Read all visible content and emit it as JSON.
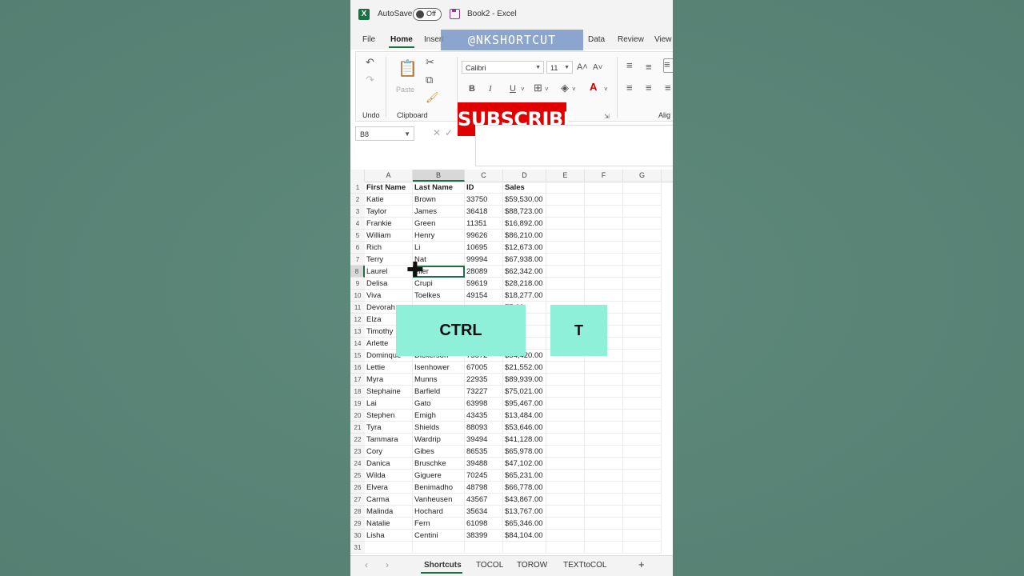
{
  "titlebar": {
    "autosave_label": "AutoSave",
    "autosave_state": "Off",
    "doc_title": "Book2  -  Excel"
  },
  "ribbon_tabs": [
    "File",
    "Home",
    "Insert",
    "Data",
    "Review",
    "View"
  ],
  "watermark": "@NKSHORTCUT",
  "ribbon": {
    "undo_group": "Undo",
    "clipboard_group": "Clipboard",
    "paste_label": "Paste",
    "font_name": "Calibri",
    "font_size": "11",
    "align_group": "Alig",
    "bold": "B",
    "italic": "I",
    "underline": "U"
  },
  "subscribe_banner": "SUBSCRIBE",
  "formula_bar": {
    "name_box": "B8"
  },
  "sheet": {
    "columns": [
      "A",
      "B",
      "C",
      "D",
      "E",
      "F",
      "G"
    ],
    "selected_column": "B",
    "selected_row": 8,
    "rows": [
      [
        "First Name",
        "Last Name",
        "ID",
        "Sales"
      ],
      [
        "Katie",
        "Brown",
        "33750",
        "$59,530.00"
      ],
      [
        "Taylor",
        "James",
        "36418",
        "$88,723.00"
      ],
      [
        "Frankie",
        "Green",
        "11351",
        "$16,892.00"
      ],
      [
        "William",
        "Henry",
        "99626",
        "$86,210.00"
      ],
      [
        "Rich",
        "Li",
        "10695",
        "$12,673.00"
      ],
      [
        "Terry",
        "Nat",
        "99994",
        "$67,938.00"
      ],
      [
        "Laurel",
        "eller",
        "28089",
        "$62,342.00"
      ],
      [
        "Delisa",
        "Crupi",
        "59619",
        "$28,218.00"
      ],
      [
        "Viva",
        "Toelkes",
        "49154",
        "$18,277.00"
      ],
      [
        "Devorah",
        "",
        "",
        "77.00"
      ],
      [
        "Elza",
        "",
        "",
        "11.00"
      ],
      [
        "Timothy",
        "",
        "",
        "58.00"
      ],
      [
        "Arlette",
        "",
        "",
        "27.00"
      ],
      [
        "Dominque",
        "Dickerson",
        "75572",
        "$54,420.00"
      ],
      [
        "Lettie",
        "Isenhower",
        "67005",
        "$21,552.00"
      ],
      [
        "Myra",
        "Munns",
        "22935",
        "$89,939.00"
      ],
      [
        "Stephaine",
        "Barfield",
        "73227",
        "$75,021.00"
      ],
      [
        "Lai",
        "Gato",
        "63998",
        "$95,467.00"
      ],
      [
        "Stephen",
        "Emigh",
        "43435",
        "$13,484.00"
      ],
      [
        "Tyra",
        "Shields",
        "88093",
        "$53,646.00"
      ],
      [
        "Tammara",
        "Wardrip",
        "39494",
        "$41,128.00"
      ],
      [
        "Cory",
        "Gibes",
        "86535",
        "$65,978.00"
      ],
      [
        "Danica",
        "Bruschke",
        "39488",
        "$47,102.00"
      ],
      [
        "Wilda",
        "Giguere",
        "70245",
        "$65,231.00"
      ],
      [
        "Elvera",
        "Benimadho",
        "48798",
        "$66,778.00"
      ],
      [
        "Carma",
        "Vanheusen",
        "43567",
        "$43,867.00"
      ],
      [
        "Malinda",
        "Hochard",
        "35634",
        "$13,767.00"
      ],
      [
        "Natalie",
        "Fern",
        "61098",
        "$65,346.00"
      ],
      [
        "Lisha",
        "Centini",
        "38399",
        "$84,104.00"
      ],
      [
        "",
        "",
        "",
        ""
      ]
    ]
  },
  "keys": {
    "key1": "CTRL",
    "key2": "T"
  },
  "sheet_tabs": [
    "Shortcuts",
    "TOCOL",
    "TOROW",
    "TEXTtoCOL"
  ],
  "add_sheet": "+",
  "colors": {
    "excel_green": "#1d6f42",
    "subscribe_red": "#e00000",
    "key_overlay": "#8ff0da",
    "background": "#5a8577"
  }
}
